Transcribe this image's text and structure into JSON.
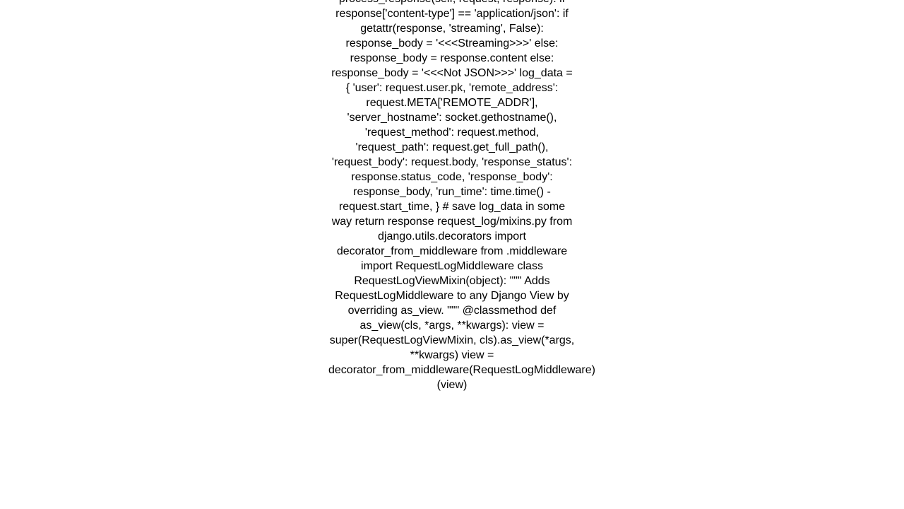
{
  "content": "process_response(self, request, response):         if response['content-type'] == 'application/json':             if getattr(response, 'streaming', False):                 response_body = '<<<Streaming>>>'             else:                 response_body = response.content         else:             response_body = '<<<Not JSON>>>'          log_data = {             'user': request.user.pk,             'remote_address': request.META['REMOTE_ADDR'],             'server_hostname': socket.gethostname(),              'request_method': request.method,             'request_path': request.get_full_path(),             'request_body': request.body,              'response_status': response.status_code,             'response_body': response_body,              'run_time': time.time() - request.start_time,         }          # save log_data in some way          return response  request_log/mixins.py  from django.utils.decorators import decorator_from_middleware  from .middleware import RequestLogMiddleware   class RequestLogViewMixin(object):     \"\"\"     Adds RequestLogMiddleware to any Django View by overriding as_view.     \"\"\"      @classmethod     def as_view(cls, *args, **kwargs):         view = super(RequestLogViewMixin, cls).as_view(*args, **kwargs)         view = decorator_from_middleware(RequestLogMiddleware)(view)"
}
